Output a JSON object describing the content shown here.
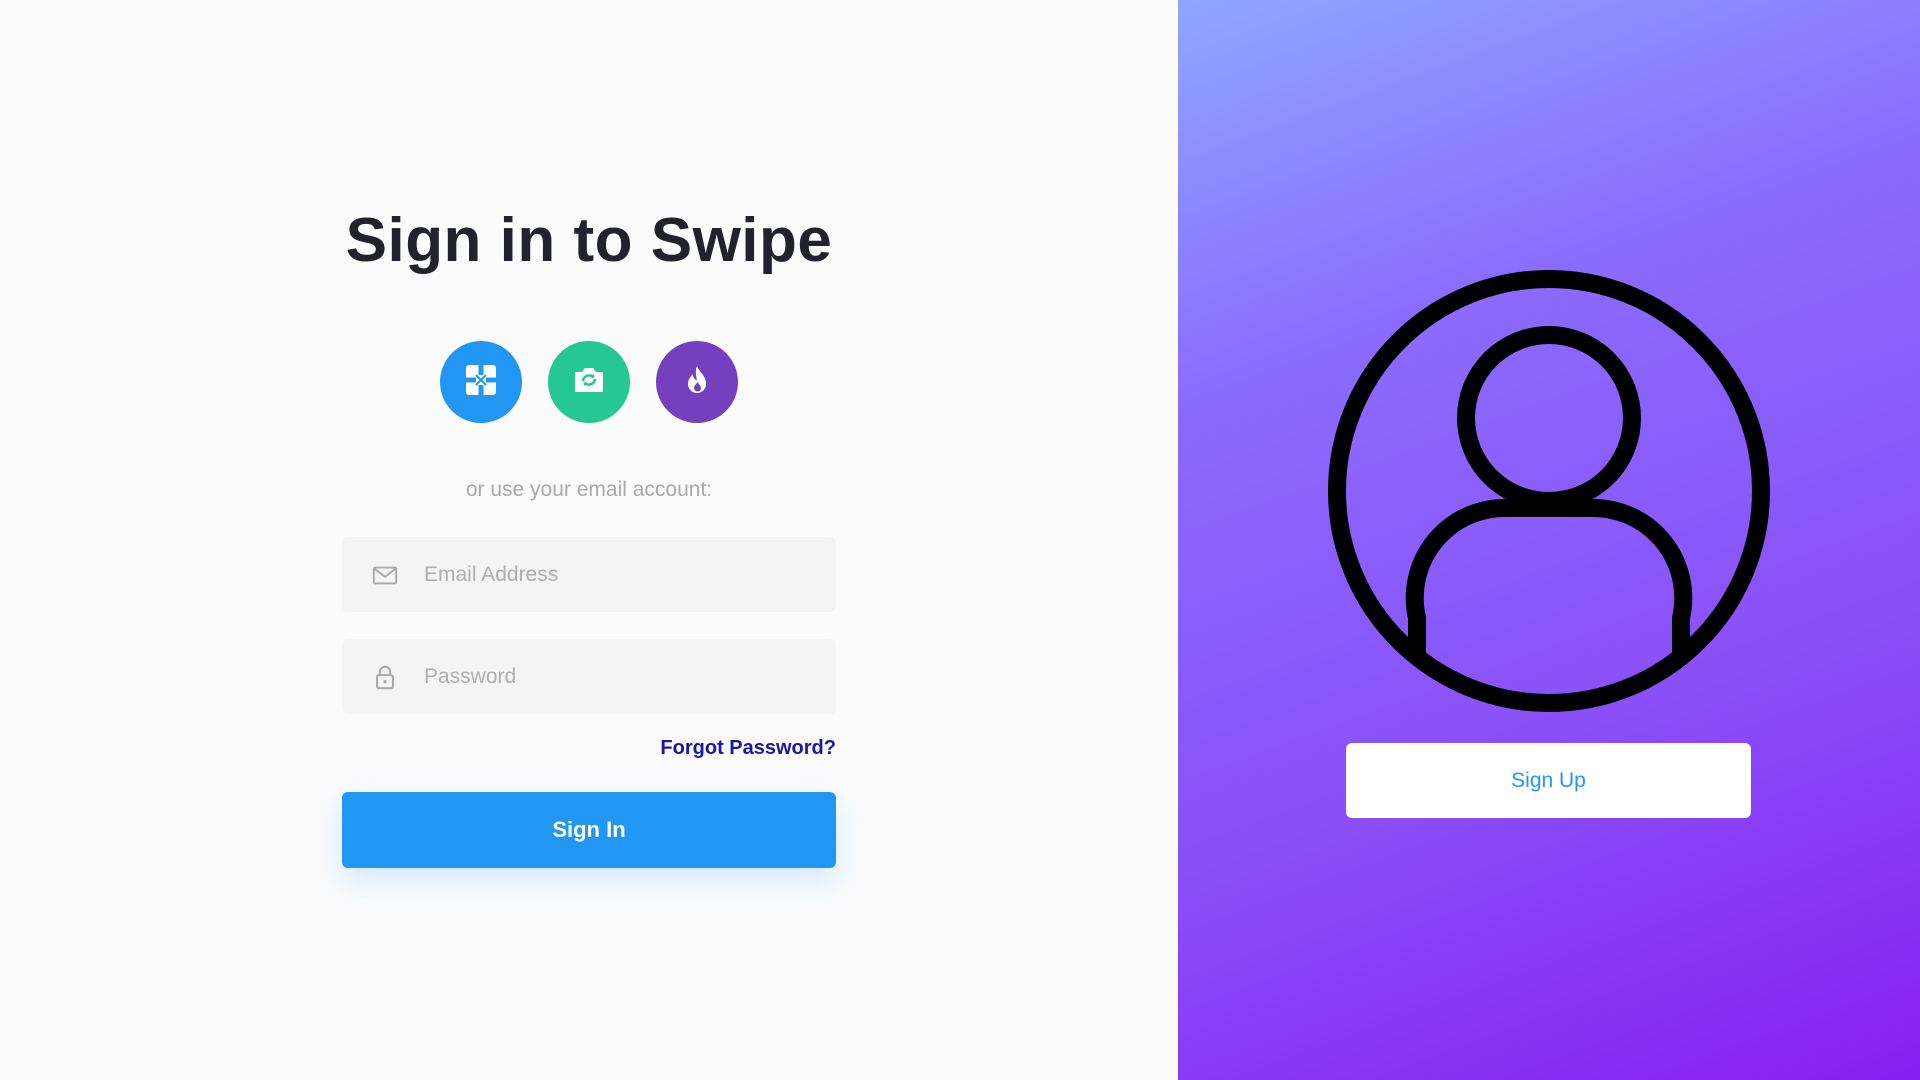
{
  "title": "Sign in to Swipe",
  "social": [
    {
      "name": "social-1",
      "icon": "cross-square-icon",
      "color": "#2196f3"
    },
    {
      "name": "social-2",
      "icon": "camera-icon",
      "color": "#25c793"
    },
    {
      "name": "social-3",
      "icon": "flame-icon",
      "color": "#7440bf"
    }
  ],
  "subtext": "or use your email account:",
  "email": {
    "placeholder": "Email Address",
    "value": "",
    "icon": "mail-icon"
  },
  "password": {
    "placeholder": "Password",
    "value": "",
    "icon": "lock-icon"
  },
  "forgot_label": "Forgot Password?",
  "signin_label": "Sign In",
  "right": {
    "avatar_icon": "user-circle-icon",
    "signup_label": "Sign Up"
  },
  "colors": {
    "primary": "#2196f3",
    "link": "#1a16a6",
    "gradient_start": "#8ea7ff",
    "gradient_end": "#861ff0"
  }
}
